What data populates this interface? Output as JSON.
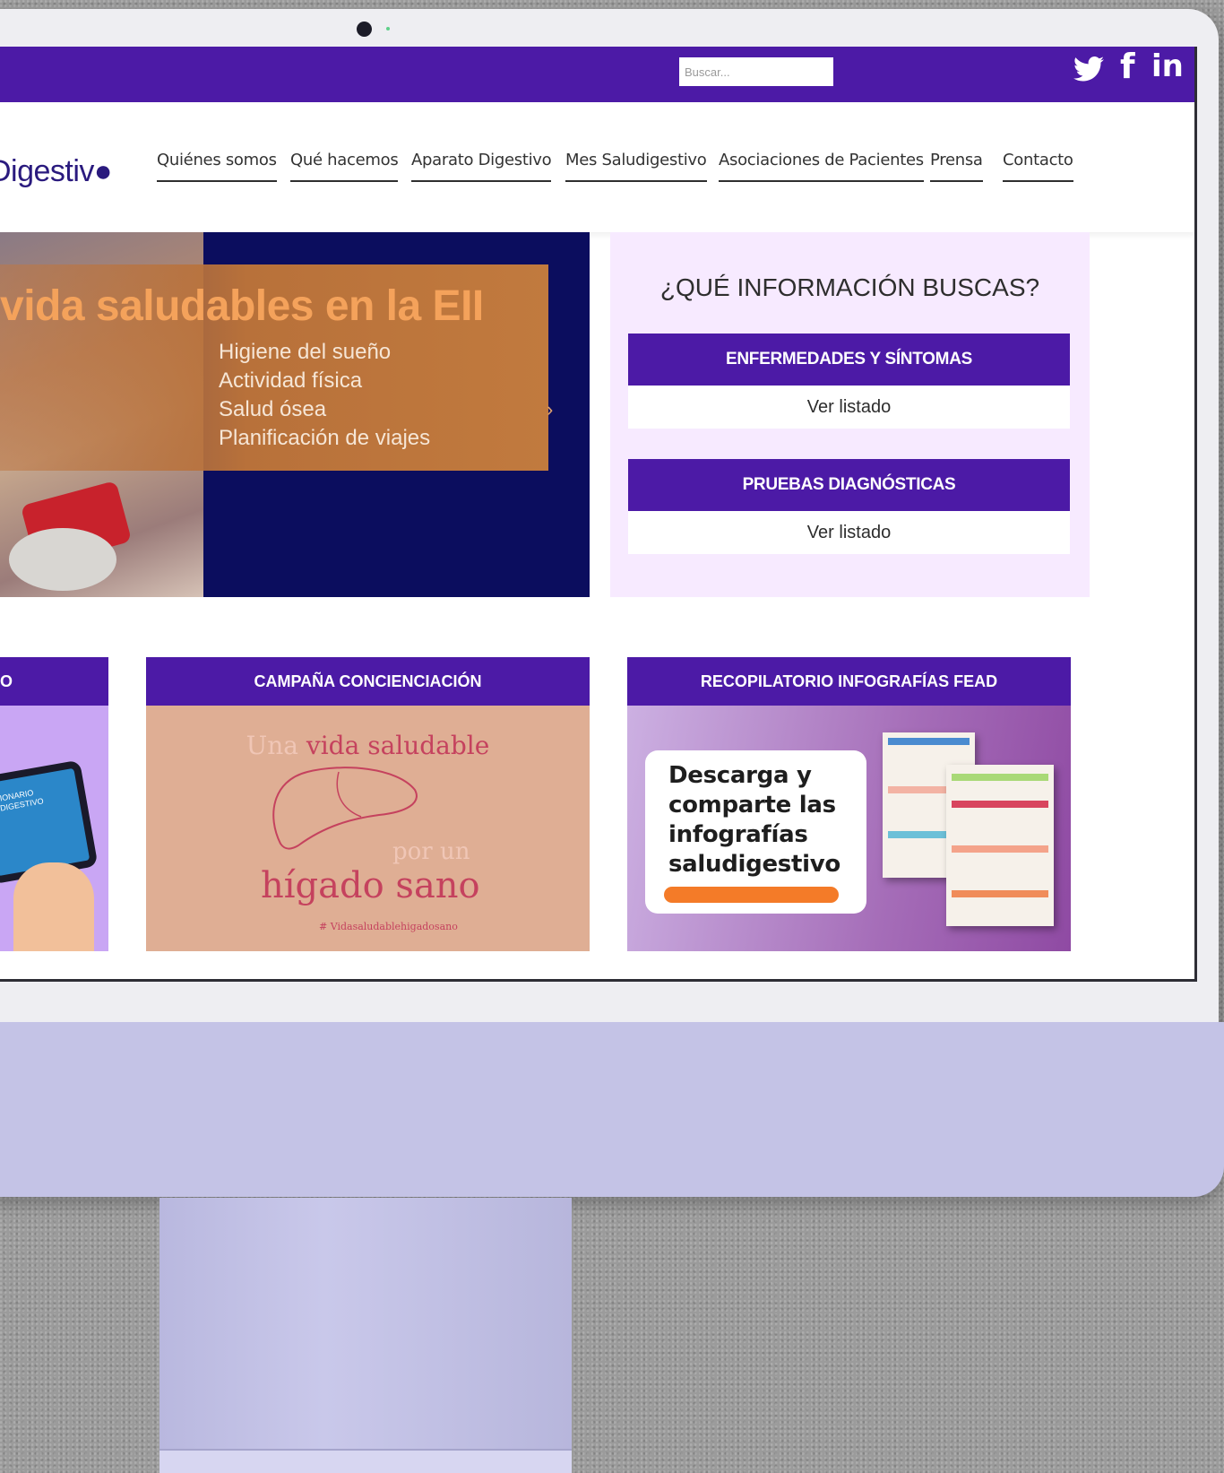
{
  "search": {
    "placeholder": "Buscar..."
  },
  "social": {
    "twitter": "🐦",
    "facebook": "f",
    "linkedin": "in"
  },
  "logo": {
    "text": "Digestiv●"
  },
  "nav": {
    "items": [
      {
        "label": "Quiénes somos"
      },
      {
        "label": "Qué hacemos"
      },
      {
        "label": "Aparato Digestivo"
      },
      {
        "label": "Mes Saludigestivo"
      },
      {
        "label": "Asociaciones de Pacientes"
      },
      {
        "label": "Prensa"
      },
      {
        "label": "Contacto"
      }
    ]
  },
  "hero": {
    "title": "vida saludables en la EII",
    "items": [
      "Higiene del sueño",
      "Actividad física",
      "Salud ósea",
      "Planificación de viajes"
    ],
    "arrow": "›"
  },
  "info": {
    "title": "¿QUÉ INFORMACIÓN BUSCAS?",
    "sections": [
      {
        "button": "ENFERMEDADES Y SÍNTOMAS",
        "link": "Ver listado"
      },
      {
        "button": "PRUEBAS DIAGNÓSTICAS",
        "link": "Ver listado"
      }
    ]
  },
  "cards": {
    "card1": {
      "title": "O",
      "tablet_text": "CCIONARIO\nLUDIGESTIVO"
    },
    "card2": {
      "title": "CAMPAÑA CONCIENCIACIÓN",
      "line1_a": "Una ",
      "line1_b": "vida saludable",
      "line2": "por un",
      "line3": "hígado sano",
      "hashtag": "# Vidasaludablehigadosano"
    },
    "card3": {
      "title": "RECOPILATORIO INFOGRAFÍAS FEAD",
      "text": "Descarga y comparte las infografías saludigestivo"
    }
  },
  "colors": {
    "brand_purple": "#4c1aa6",
    "hero_navy": "#0b0d5e",
    "hero_orange": "#c17a3e",
    "info_bg": "#f7eaff"
  }
}
